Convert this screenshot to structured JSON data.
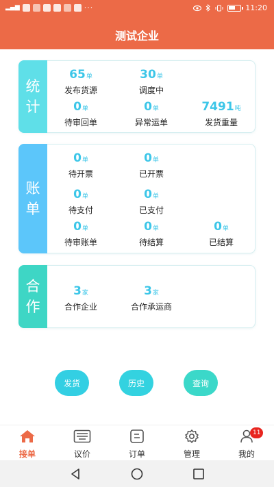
{
  "status_bar": {
    "time": "11:20",
    "more": "···"
  },
  "header": {
    "title": "测试企业"
  },
  "stats_card": {
    "tag": [
      "统",
      "计"
    ],
    "items": [
      {
        "value": "65",
        "unit": "单",
        "label": "发布货源"
      },
      {
        "value": "30",
        "unit": "单",
        "label": "调度中"
      },
      {
        "value": "0",
        "unit": "单",
        "label": "待审回单"
      },
      {
        "value": "0",
        "unit": "单",
        "label": "异常运单"
      },
      {
        "value": "7491",
        "unit": "吨",
        "label": "发货重量"
      }
    ]
  },
  "bills_card": {
    "tag": [
      "账",
      "单"
    ],
    "items": [
      {
        "value": "0",
        "unit": "单",
        "label": "待开票"
      },
      {
        "value": "0",
        "unit": "单",
        "label": "已开票"
      },
      {
        "value": "0",
        "unit": "单",
        "label": "待支付"
      },
      {
        "value": "0",
        "unit": "单",
        "label": "已支付"
      },
      {
        "value": "0",
        "unit": "单",
        "label": "待审账单"
      },
      {
        "value": "0",
        "unit": "单",
        "label": "待结算"
      },
      {
        "value": "0",
        "unit": "单",
        "label": "已结算"
      }
    ]
  },
  "coop_card": {
    "tag": [
      "合",
      "作"
    ],
    "items": [
      {
        "value": "3",
        "unit": "家",
        "label": "合作企业"
      },
      {
        "value": "3",
        "unit": "家",
        "label": "合作承运商"
      }
    ]
  },
  "actions": {
    "ship": "发货",
    "history": "历史",
    "query": "查询"
  },
  "tabs": [
    {
      "label": "接单",
      "icon": "home-icon"
    },
    {
      "label": "议价",
      "icon": "keyboard-icon"
    },
    {
      "label": "订单",
      "icon": "order-icon"
    },
    {
      "label": "管理",
      "icon": "gear-icon"
    },
    {
      "label": "我的",
      "icon": "person-icon",
      "badge": "11"
    }
  ],
  "colors": {
    "brand": "#ec6a47",
    "accent": "#3cc6e8",
    "badge": "#e8251f"
  }
}
